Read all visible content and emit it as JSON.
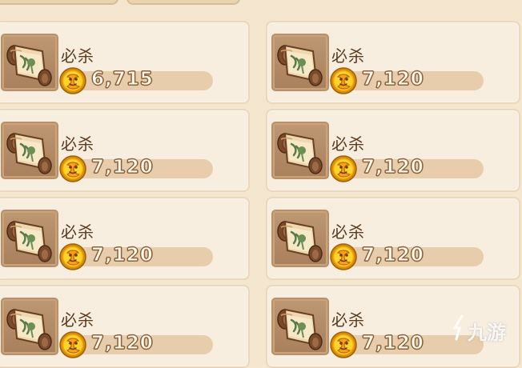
{
  "skills": [
    {
      "name": "必杀",
      "price": "6,715",
      "icon": "scroll-icon",
      "coin_icon": "gold-coin-icon"
    },
    {
      "name": "必杀",
      "price": "7,120",
      "icon": "scroll-icon",
      "coin_icon": "gold-coin-icon"
    },
    {
      "name": "必杀",
      "price": "7,120",
      "icon": "scroll-icon",
      "coin_icon": "gold-coin-icon"
    },
    {
      "name": "必杀",
      "price": "7,120",
      "icon": "scroll-icon",
      "coin_icon": "gold-coin-icon"
    },
    {
      "name": "必杀",
      "price": "7,120",
      "icon": "scroll-icon",
      "coin_icon": "gold-coin-icon"
    },
    {
      "name": "必杀",
      "price": "7,120",
      "icon": "scroll-icon",
      "coin_icon": "gold-coin-icon"
    },
    {
      "name": "必杀",
      "price": "7,120",
      "icon": "scroll-icon",
      "coin_icon": "gold-coin-icon"
    },
    {
      "name": "必杀",
      "price": "7,120",
      "icon": "scroll-icon",
      "coin_icon": "gold-coin-icon"
    }
  ],
  "watermark": {
    "text": "九游"
  },
  "colors": {
    "background": "#f4e6cf",
    "card": "#f8eee0",
    "card_border": "#ead7bc",
    "price_bar": "#e7cdab",
    "text_brown": "#5b3a1e",
    "coin_gold": "#f2b817"
  }
}
